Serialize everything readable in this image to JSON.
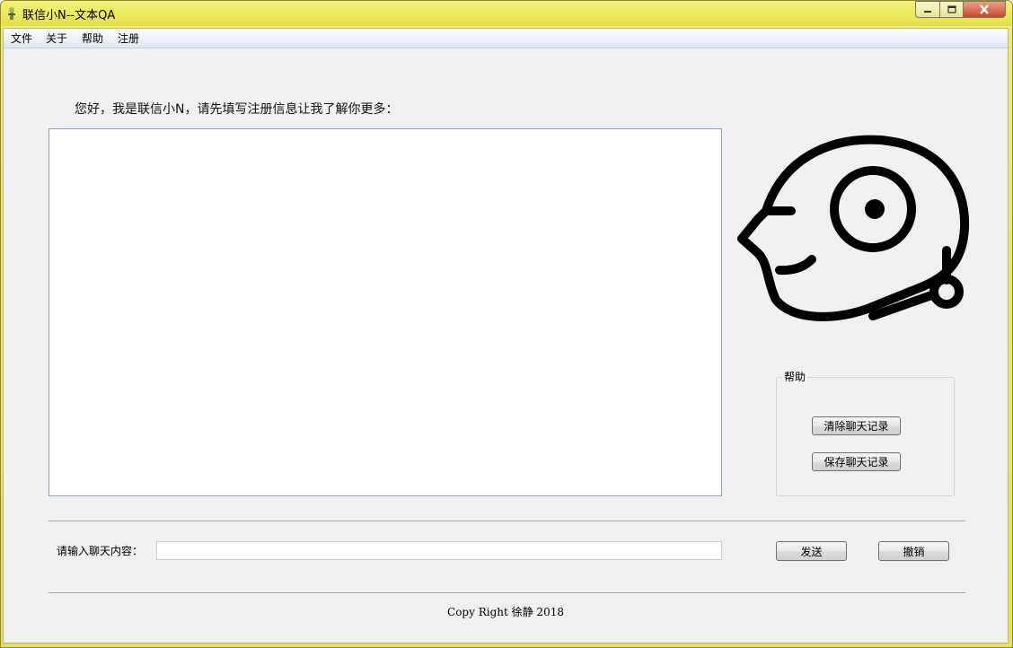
{
  "window": {
    "title": "联信小N--文本QA",
    "controls": {
      "minimize_icon": "minimize-icon",
      "maximize_icon": "maximize-icon",
      "close_icon": "close-icon"
    }
  },
  "menu": {
    "items": [
      {
        "label": "文件"
      },
      {
        "label": "关于"
      },
      {
        "label": "帮助"
      },
      {
        "label": "注册"
      }
    ]
  },
  "main": {
    "greeting": "您好，我是联信小N，请先填写注册信息让我了解你更多：",
    "chat_log": "",
    "avatar_icon": "robot-head-icon"
  },
  "help_group": {
    "title": "帮助",
    "clear_label": "清除聊天记录",
    "save_label": "保存聊天记录"
  },
  "input_row": {
    "label": "请输入聊天内容：",
    "value": "",
    "placeholder": "",
    "send_label": "发送",
    "cancel_label": "撤销"
  },
  "footer": {
    "copyright": "Copy Right 徐静 2018"
  },
  "colors": {
    "titlebar": "#ece85a",
    "client_bg": "#f0f0f0",
    "close_button": "#c8452c"
  }
}
